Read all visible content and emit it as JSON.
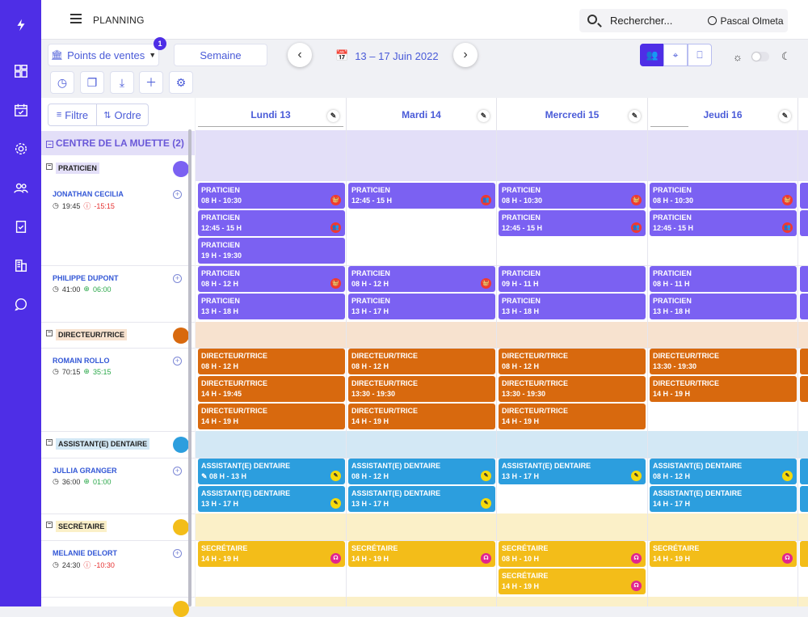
{
  "app": {
    "title": "PLANNING"
  },
  "search": {
    "label": "Rechercher...",
    "chevron": "⌄"
  },
  "user": {
    "name": "Pascal Olmeta"
  },
  "sidebar": {
    "icons": [
      "logo-icon",
      "dashboard-icon",
      "calendar-check-icon",
      "settings-icon",
      "users-icon",
      "clipboard-check-icon",
      "building-icon",
      "chat-icon"
    ]
  },
  "toolbar": {
    "points_label": "Points de ventes",
    "points_badge": "1",
    "week_label": "Semaine",
    "prev": "‹",
    "next": "›",
    "date_range": "13 – 17 Juin 2022",
    "filter_label": "Filtre",
    "order_label": "Ordre"
  },
  "days": [
    {
      "label": "Lundi 13"
    },
    {
      "label": "Mardi 14"
    },
    {
      "label": "Mercredi 15"
    },
    {
      "label": "Jeudi 16"
    }
  ],
  "group": {
    "name": "CENTRE DE LA MUETTE (2)"
  },
  "roles": [
    {
      "name": "PRATICIEN",
      "color": "#7b61f2"
    },
    {
      "name": "DIRECTEUR/TRICE",
      "color": "#d8690e"
    },
    {
      "name": "ASSISTANT(E) DENTAIRE",
      "color": "#2c9ede"
    },
    {
      "name": "SECRÉTAIRE",
      "color": "#f3bd19"
    }
  ],
  "people": [
    {
      "name": "JONATHAN CECILIA",
      "hours": "19:45",
      "delta": "-15:15"
    },
    {
      "name": "PHILIPPE DUPONT",
      "hours": "41:00",
      "delta": "06:00"
    },
    {
      "name": "ROMAIN ROLLO",
      "hours": "70:15",
      "delta": "35:15"
    },
    {
      "name": "JULLIA GRANGER",
      "hours": "36:00",
      "delta": "01:00"
    },
    {
      "name": "MELANIE DELORT",
      "hours": "24:30",
      "delta": "-10:30"
    }
  ],
  "events": [
    {
      "col": 0,
      "row": 0,
      "role": "PRATICIEN",
      "time": "08 H - 10:30",
      "cls": "c-prat",
      "icon": "🧺",
      "ic": "ic-red"
    },
    {
      "col": 0,
      "row": 1,
      "role": "PRATICIEN",
      "time": "12:45 - 15 H",
      "cls": "c-prat",
      "icon": "👥",
      "ic": "ic-red"
    },
    {
      "col": 0,
      "row": 2,
      "role": "PRATICIEN",
      "time": "19 H - 19:30",
      "cls": "c-prat",
      "icon": "",
      "ic": ""
    },
    {
      "col": 1,
      "row": 0,
      "role": "PRATICIEN",
      "time": "12:45 - 15 H",
      "cls": "c-prat",
      "icon": "👥",
      "ic": "ic-red"
    },
    {
      "col": 2,
      "row": 0,
      "role": "PRATICIEN",
      "time": "08 H - 10:30",
      "cls": "c-prat",
      "icon": "🧺",
      "ic": "ic-red"
    },
    {
      "col": 2,
      "row": 1,
      "role": "PRATICIEN",
      "time": "12:45 - 15 H",
      "cls": "c-prat",
      "icon": "👥",
      "ic": "ic-red"
    },
    {
      "col": 3,
      "row": 0,
      "role": "PRATICIEN",
      "time": "08 H - 10:30",
      "cls": "c-prat",
      "icon": "🧺",
      "ic": "ic-red"
    },
    {
      "col": 3,
      "row": 1,
      "role": "PRATICIEN",
      "time": "12:45 - 15 H",
      "cls": "c-prat",
      "icon": "👥",
      "ic": "ic-red"
    },
    {
      "col": 0,
      "row": 3,
      "role": "PRATICIEN",
      "time": "08 H - 12 H",
      "cls": "c-prat",
      "icon": "🧺",
      "ic": "ic-red"
    },
    {
      "col": 0,
      "row": 4,
      "role": "PRATICIEN",
      "time": "13 H - 18 H",
      "cls": "c-prat",
      "icon": "",
      "ic": ""
    },
    {
      "col": 1,
      "row": 3,
      "role": "PRATICIEN",
      "time": "08 H - 12 H",
      "cls": "c-prat",
      "icon": "🧺",
      "ic": "ic-red"
    },
    {
      "col": 1,
      "row": 4,
      "role": "PRATICIEN",
      "time": "13 H - 17 H",
      "cls": "c-prat",
      "icon": "",
      "ic": ""
    },
    {
      "col": 2,
      "row": 3,
      "role": "PRATICIEN",
      "time": "09 H - 11 H",
      "cls": "c-prat",
      "icon": "",
      "ic": ""
    },
    {
      "col": 2,
      "row": 4,
      "role": "PRATICIEN",
      "time": "13 H - 18 H",
      "cls": "c-prat",
      "icon": "",
      "ic": ""
    },
    {
      "col": 3,
      "row": 3,
      "role": "PRATICIEN",
      "time": "08 H - 11 H",
      "cls": "c-prat",
      "icon": "",
      "ic": ""
    },
    {
      "col": 3,
      "row": 4,
      "role": "PRATICIEN",
      "time": "13 H - 18 H",
      "cls": "c-prat",
      "icon": "",
      "ic": ""
    },
    {
      "col": 0,
      "row": 5,
      "role": "DIRECTEUR/TRICE",
      "time": "08 H - 12 H",
      "cls": "c-dir",
      "icon": "",
      "ic": ""
    },
    {
      "col": 0,
      "row": 6,
      "role": "DIRECTEUR/TRICE",
      "time": "14 H - 19:45",
      "cls": "c-dir",
      "icon": "",
      "ic": ""
    },
    {
      "col": 0,
      "row": 7,
      "role": "DIRECTEUR/TRICE",
      "time": "14 H - 19 H",
      "cls": "c-dir",
      "icon": "",
      "ic": ""
    },
    {
      "col": 1,
      "row": 5,
      "role": "DIRECTEUR/TRICE",
      "time": "08 H - 12 H",
      "cls": "c-dir",
      "icon": "",
      "ic": ""
    },
    {
      "col": 1,
      "row": 6,
      "role": "DIRECTEUR/TRICE",
      "time": "13:30 - 19:30",
      "cls": "c-dir",
      "icon": "",
      "ic": ""
    },
    {
      "col": 1,
      "row": 7,
      "role": "DIRECTEUR/TRICE",
      "time": "14 H - 19 H",
      "cls": "c-dir",
      "icon": "",
      "ic": ""
    },
    {
      "col": 2,
      "row": 5,
      "role": "DIRECTEUR/TRICE",
      "time": "08 H - 12 H",
      "cls": "c-dir",
      "icon": "",
      "ic": ""
    },
    {
      "col": 2,
      "row": 6,
      "role": "DIRECTEUR/TRICE",
      "time": "13:30 - 19:30",
      "cls": "c-dir",
      "icon": "",
      "ic": ""
    },
    {
      "col": 2,
      "row": 7,
      "role": "DIRECTEUR/TRICE",
      "time": "14 H - 19 H",
      "cls": "c-dir",
      "icon": "",
      "ic": ""
    },
    {
      "col": 3,
      "row": 5,
      "role": "DIRECTEUR/TRICE",
      "time": "13:30 - 19:30",
      "cls": "c-dir",
      "icon": "",
      "ic": ""
    },
    {
      "col": 3,
      "row": 6,
      "role": "DIRECTEUR/TRICE",
      "time": "14 H - 19 H",
      "cls": "c-dir",
      "icon": "",
      "ic": ""
    },
    {
      "col": 0,
      "row": 8,
      "role": "ASSISTANT(E) DENTAIRE",
      "time": "✎ 08 H - 13 H",
      "cls": "c-ass",
      "icon": "✎",
      "ic": "ic-yel"
    },
    {
      "col": 0,
      "row": 9,
      "role": "ASSISTANT(E) DENTAIRE",
      "time": "13 H - 17 H",
      "cls": "c-ass",
      "icon": "✎",
      "ic": "ic-yel"
    },
    {
      "col": 1,
      "row": 8,
      "role": "ASSISTANT(E) DENTAIRE",
      "time": "08 H - 12 H",
      "cls": "c-ass",
      "icon": "✎",
      "ic": "ic-yel"
    },
    {
      "col": 1,
      "row": 9,
      "role": "ASSISTANT(E) DENTAIRE",
      "time": "13 H - 17 H",
      "cls": "c-ass",
      "icon": "✎",
      "ic": "ic-yel"
    },
    {
      "col": 2,
      "row": 8,
      "role": "ASSISTANT(E) DENTAIRE",
      "time": "13 H - 17 H",
      "cls": "c-ass",
      "icon": "✎",
      "ic": "ic-yel"
    },
    {
      "col": 3,
      "row": 8,
      "role": "ASSISTANT(E) DENTAIRE",
      "time": "08 H - 12 H",
      "cls": "c-ass",
      "icon": "✎",
      "ic": "ic-yel"
    },
    {
      "col": 3,
      "row": 9,
      "role": "ASSISTANT(E) DENTAIRE",
      "time": "14 H - 17 H",
      "cls": "c-ass",
      "icon": "",
      "ic": ""
    },
    {
      "col": 0,
      "row": 10,
      "role": "SECRÉTAIRE",
      "time": "14 H - 19 H",
      "cls": "c-sec",
      "icon": "☊",
      "ic": "ic-mag"
    },
    {
      "col": 1,
      "row": 10,
      "role": "SECRÉTAIRE",
      "time": "14 H - 19 H",
      "cls": "c-sec",
      "icon": "☊",
      "ic": "ic-mag"
    },
    {
      "col": 2,
      "row": 10,
      "role": "SECRÉTAIRE",
      "time": "08 H - 10 H",
      "cls": "c-sec",
      "icon": "☊",
      "ic": "ic-mag"
    },
    {
      "col": 2,
      "row": 11,
      "role": "SECRÉTAIRE",
      "time": "14 H - 19 H",
      "cls": "c-sec",
      "icon": "☊",
      "ic": "ic-mag"
    },
    {
      "col": 3,
      "row": 10,
      "role": "SECRÉTAIRE",
      "time": "14 H - 19 H",
      "cls": "c-sec",
      "icon": "☊",
      "ic": "ic-mag"
    }
  ]
}
